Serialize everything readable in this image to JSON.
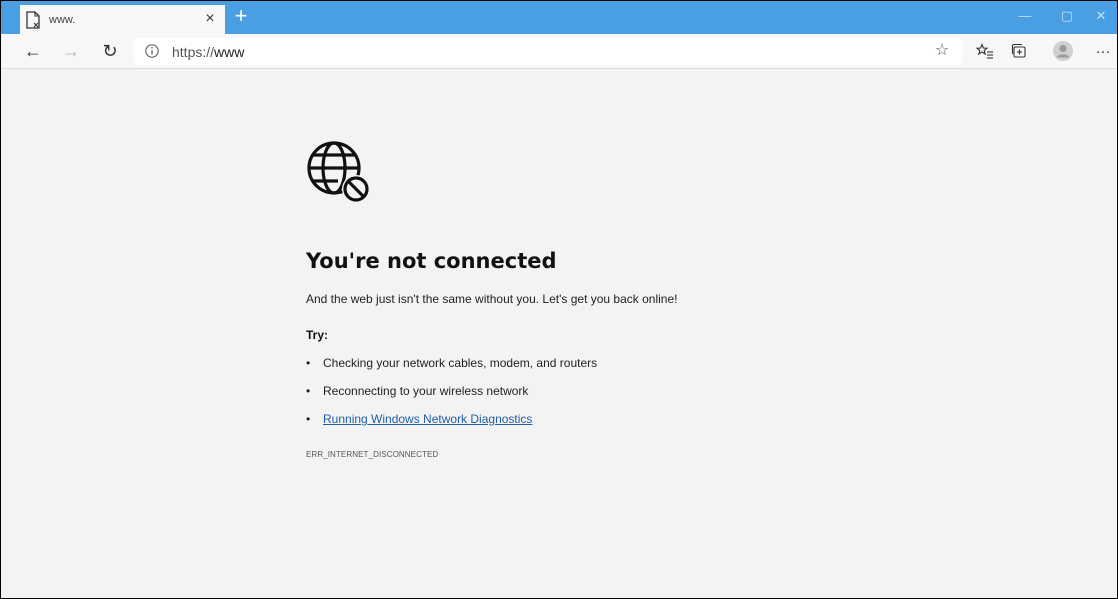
{
  "tab": {
    "title": "www.",
    "close_glyph": "×"
  },
  "new_tab_glyph": "+",
  "window_controls": {
    "minimize": "—",
    "restore": "▢",
    "close": "✕"
  },
  "nav": {
    "back_glyph": "←",
    "forward_glyph": "→",
    "refresh_glyph": "↻"
  },
  "address": {
    "scheme": "https://",
    "host": "www"
  },
  "toolbar": {
    "favorite_glyph": "☆",
    "more_glyph": "···"
  },
  "page": {
    "heading": "You're not connected",
    "description": "And the web just isn't the same without you. Let's get you back online!",
    "try_label": "Try:",
    "suggestions": [
      {
        "text": "Checking your network cables, modem, and routers",
        "link": false
      },
      {
        "text": "Reconnecting to your wireless network",
        "link": false
      },
      {
        "text": "Running Windows Network Diagnostics",
        "link": true
      }
    ],
    "error_code": "ERR_INTERNET_DISCONNECTED"
  },
  "colors": {
    "tabbar": "#4a9ee2",
    "link": "#1f5da8",
    "background": "#f3f3f3"
  },
  "icons": [
    "page-icon",
    "close-icon",
    "plus-icon",
    "back-icon",
    "forward-icon",
    "refresh-icon",
    "info-icon",
    "star-icon",
    "favorites-icon",
    "collections-icon",
    "profile-icon",
    "more-icon",
    "globe-blocked-icon"
  ]
}
